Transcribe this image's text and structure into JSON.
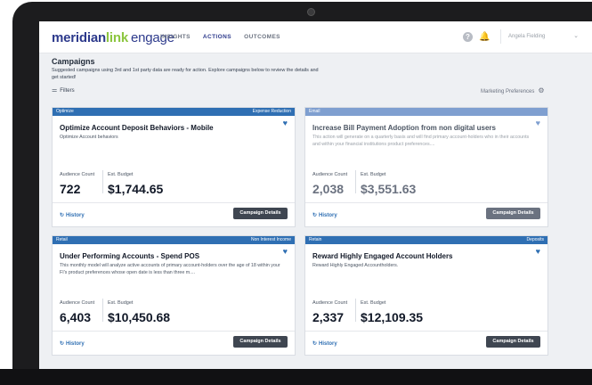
{
  "app": {
    "logo_part1": "meridian",
    "logo_part2": "link",
    "logo_part3": "engage"
  },
  "nav": {
    "items": [
      "INSIGHTS",
      "ACTIONS",
      "OUTCOMES"
    ],
    "active": "ACTIONS"
  },
  "header": {
    "user_name": "Angela Fielding",
    "help_glyph": "?",
    "bell_glyph": "🔔",
    "chevron_glyph": "⌄"
  },
  "page": {
    "title": "Campaigns",
    "description": "Suggested campaigns using 3rd and 1st party data are ready for action. Explore campaigns below to review the details and get started!",
    "filters_label": "Filters",
    "filters_icon": "⚌",
    "marketing_label": "Marketing Preferences",
    "gear_icon": "⚙"
  },
  "cards": [
    {
      "category": "Optimize",
      "tag": "Expense Reduction",
      "title": "Optimize Account Deposit Behaviors - Mobile",
      "description": "Optimize Account behaviors",
      "audience_label": "Audience Count",
      "audience_value": "722",
      "budget_label": "Est. Budget",
      "budget_value": "$1,744.65",
      "history_label": "History",
      "button_label": "Campaign Details",
      "heart": "♥"
    },
    {
      "category": "Email",
      "tag": "",
      "title": "Increase Bill Payment Adoption from non digital users",
      "description": "This action will generate on a quarterly basis and will find primary account-holders who in their accounts and within your financial institutions product preferences....",
      "audience_label": "Audience Count",
      "audience_value": "2,038",
      "budget_label": "Est. Budget",
      "budget_value": "$3,551.63",
      "history_label": "History",
      "button_label": "Campaign Details",
      "heart": "♥"
    },
    {
      "category": "Retail",
      "tag": "Non Interest Income",
      "title": "Under Performing Accounts - Spend POS",
      "description": "This monthly model will analyze active accounts of primary account-holders over the age of 18 within your FI's product preferences whose open date is less than three m....",
      "audience_label": "Audience Count",
      "audience_value": "6,403",
      "budget_label": "Est. Budget",
      "budget_value": "$10,450.68",
      "history_label": "History",
      "button_label": "Campaign Details",
      "heart": "♥"
    },
    {
      "category": "Retain",
      "tag": "Deposits",
      "title": "Reward Highly Engaged Account Holders",
      "description": "Reward Highly Engaged Accountholders.",
      "audience_label": "Audience Count",
      "audience_value": "2,337",
      "budget_label": "Est. Budget",
      "budget_value": "$12,109.35",
      "history_label": "History",
      "button_label": "Campaign Details",
      "heart": "♥"
    }
  ],
  "icons": {
    "history": "↻"
  },
  "colors": {
    "brand_navy": "#2d3a8c",
    "brand_green": "#8cc63f",
    "card_header_blue": "#2f6fb3",
    "card_header_light": "#7f9fd0",
    "button_dark": "#3f4651"
  }
}
